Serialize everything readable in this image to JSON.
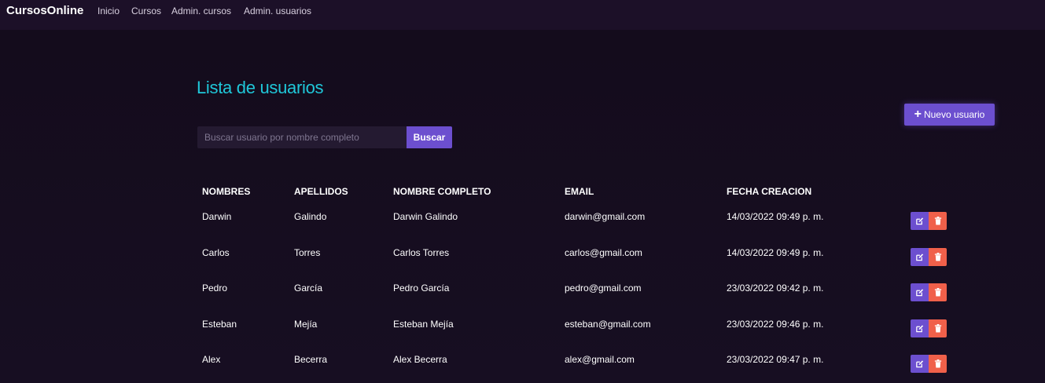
{
  "navbar": {
    "brand": "CursosOnline",
    "links": [
      "Inicio",
      "Cursos",
      "Admin. cursos",
      "Admin. usuarios"
    ]
  },
  "page": {
    "title": "Lista de usuarios",
    "new_button": "Nuevo usuario",
    "search": {
      "placeholder": "Buscar usuario por nombre completo",
      "value": "",
      "button": "Buscar"
    }
  },
  "table": {
    "headers": [
      "NOMBRES",
      "APELLIDOS",
      "NOMBRE COMPLETO",
      "EMAIL",
      "FECHA CREACION"
    ],
    "rows": [
      [
        "Darwin",
        "Galindo",
        "Darwin Galindo",
        "darwin@gmail.com",
        "14/03/2022 09:49 p. m."
      ],
      [
        "Carlos",
        "Torres",
        "Carlos Torres",
        "carlos@gmail.com",
        "14/03/2022 09:49 p. m."
      ],
      [
        "Pedro",
        "García",
        "Pedro García",
        "pedro@gmail.com",
        "23/03/2022 09:42 p. m."
      ],
      [
        "Esteban",
        "Mejía",
        "Esteban Mejía",
        "esteban@gmail.com",
        "23/03/2022 09:46 p. m."
      ],
      [
        "Alex",
        "Becerra",
        "Alex Becerra",
        "alex@gmail.com",
        "23/03/2022 09:47 p. m."
      ]
    ]
  },
  "icons": {
    "edit": "edit-icon",
    "delete": "trash-icon",
    "add": "plus-icon"
  },
  "colors": {
    "accent": "#6c4fcf",
    "title": "#1fc7d9",
    "danger": "#f0604a"
  }
}
